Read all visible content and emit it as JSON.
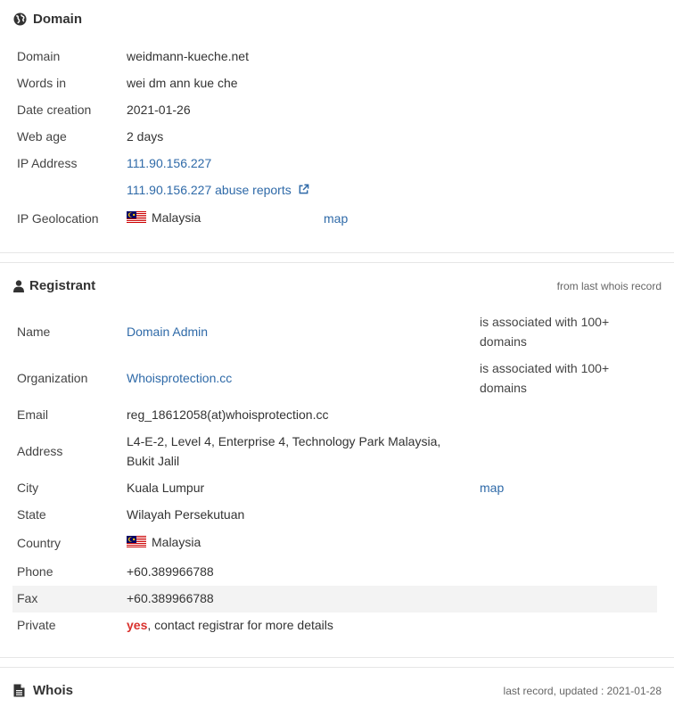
{
  "domain_section": {
    "title": "Domain",
    "rows": {
      "domain": {
        "label": "Domain",
        "value": "weidmann-kueche.net"
      },
      "words": {
        "label": "Words in",
        "value": "wei dm ann kue che"
      },
      "date_creation": {
        "label": "Date creation",
        "value": "2021-01-26"
      },
      "web_age": {
        "label": "Web age",
        "value": "2 days"
      },
      "ip_address": {
        "label": "IP Address",
        "value": "111.90.156.227"
      },
      "abuse": {
        "value": "111.90.156.227 abuse reports"
      },
      "ip_geo": {
        "label": "IP Geolocation",
        "value": "Malaysia",
        "map_link": "map"
      }
    }
  },
  "registrant_section": {
    "title": "Registrant",
    "note": "from last whois record",
    "rows": {
      "name": {
        "label": "Name",
        "value": "Domain Admin",
        "extra": "is associated with 100+ domains"
      },
      "organization": {
        "label": "Organization",
        "value": "Whoisprotection.cc",
        "extra": "is associated with 100+ domains"
      },
      "email": {
        "label": "Email",
        "value": "reg_18612058(at)whoisprotection.cc"
      },
      "address": {
        "label": "Address",
        "value": "L4-E-2, Level 4, Enterprise 4, Technology Park Malaysia, Bukit Jalil"
      },
      "city": {
        "label": "City",
        "value": "Kuala Lumpur",
        "map_link": "map"
      },
      "state": {
        "label": "State",
        "value": "Wilayah Persekutuan"
      },
      "country": {
        "label": "Country",
        "value": "Malaysia"
      },
      "phone": {
        "label": "Phone",
        "value": "+60.389966788"
      },
      "fax": {
        "label": "Fax",
        "value": "+60.389966788"
      },
      "private": {
        "label": "Private",
        "value_highlight": "yes",
        "value_rest": ", contact registrar for more details"
      }
    }
  },
  "whois_section": {
    "title": "Whois",
    "note": "last record, updated : 2021-01-28"
  },
  "colors": {
    "link": "#2f6aa8",
    "highlight_red": "#d9302c",
    "row_highlight": "#f3f3f3"
  },
  "icons": {
    "domain": "globe-icon",
    "registrant": "user-icon",
    "whois": "document-icon",
    "external": "external-link-icon",
    "flag": "malaysia-flag-icon"
  }
}
